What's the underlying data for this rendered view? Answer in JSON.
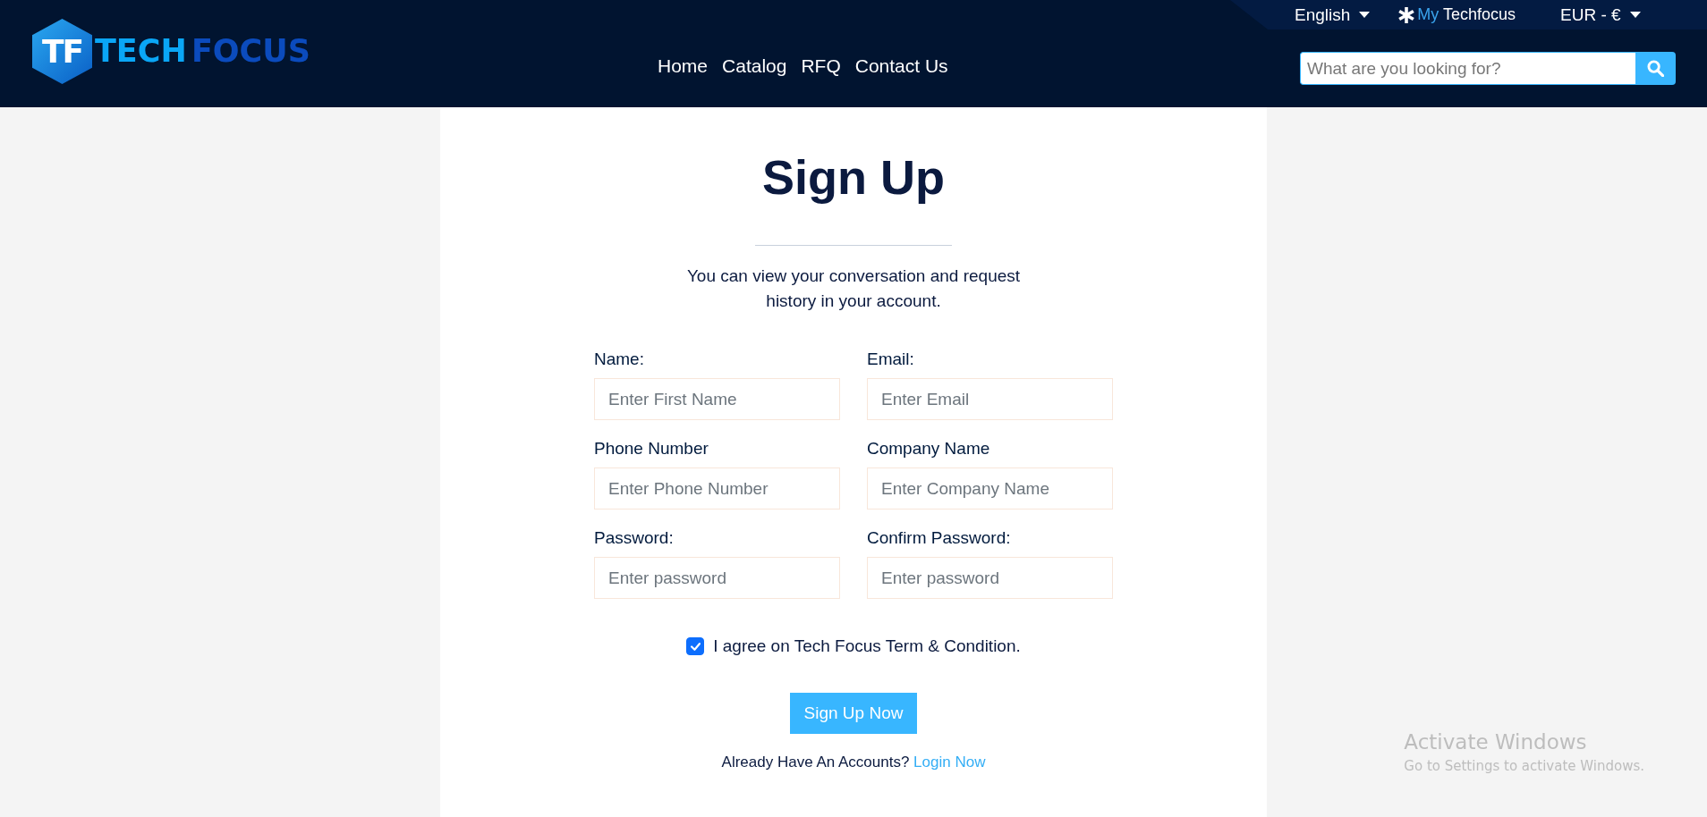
{
  "header": {
    "logo": {
      "mark": "TF",
      "words": [
        "TECH",
        "FOCUS"
      ]
    },
    "top_bar": {
      "language": "English",
      "account": {
        "prefix": "My",
        "label": "Techfocus"
      },
      "currency": "EUR - €"
    },
    "nav": [
      "Home",
      "Catalog",
      "RFQ",
      "Contact Us"
    ],
    "search": {
      "placeholder": "What are you looking for?"
    }
  },
  "form": {
    "title": "Sign Up",
    "description": "You can view your conversation and request history in your account.",
    "fields": [
      {
        "label": "Name:",
        "placeholder": "Enter First Name"
      },
      {
        "label": "Email:",
        "placeholder": "Enter Email"
      },
      {
        "label": "Phone Number",
        "placeholder": "Enter Phone Number"
      },
      {
        "label": "Company Name",
        "placeholder": "Enter Company Name"
      },
      {
        "label": "Password:",
        "placeholder": "Enter password"
      },
      {
        "label": "Confirm Password:",
        "placeholder": "Enter password"
      }
    ],
    "agree": {
      "label": "I agree on Tech Focus Term & Condition.",
      "checked": true
    },
    "submit": "Sign Up Now",
    "login": {
      "prompt": "Already Have An Accounts?",
      "link": "Login Now"
    }
  },
  "os_notice": {
    "title": "Activate Windows",
    "text": "Go to Settings to activate Windows."
  }
}
